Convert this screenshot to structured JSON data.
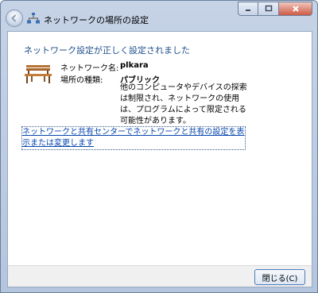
{
  "window": {
    "title": "ネットワークの場所の設定",
    "controls": {
      "minimize_icon": "minimize-icon",
      "maximize_icon": "maximize-icon",
      "close_icon": "close-icon"
    }
  },
  "content": {
    "heading": "ネットワーク設定が正しく設定されました",
    "network_name_label": "ネットワーク名:",
    "network_name_value": "plkara",
    "location_type_label": "場所の種類:",
    "location_type_value": "パブリック",
    "description": "他のコンピュータやデバイスの探索は制限され、ネットワークの使用は、プログラムによって限定される可能性があります。",
    "link": "ネットワークと共有センターでネットワークと共有の設定を表示または変更します"
  },
  "footer": {
    "close_button": "閉じる(C)"
  },
  "colors": {
    "heading": "#1f4e8c",
    "link": "#0645ad",
    "title_bar": "#c6d3e6"
  }
}
